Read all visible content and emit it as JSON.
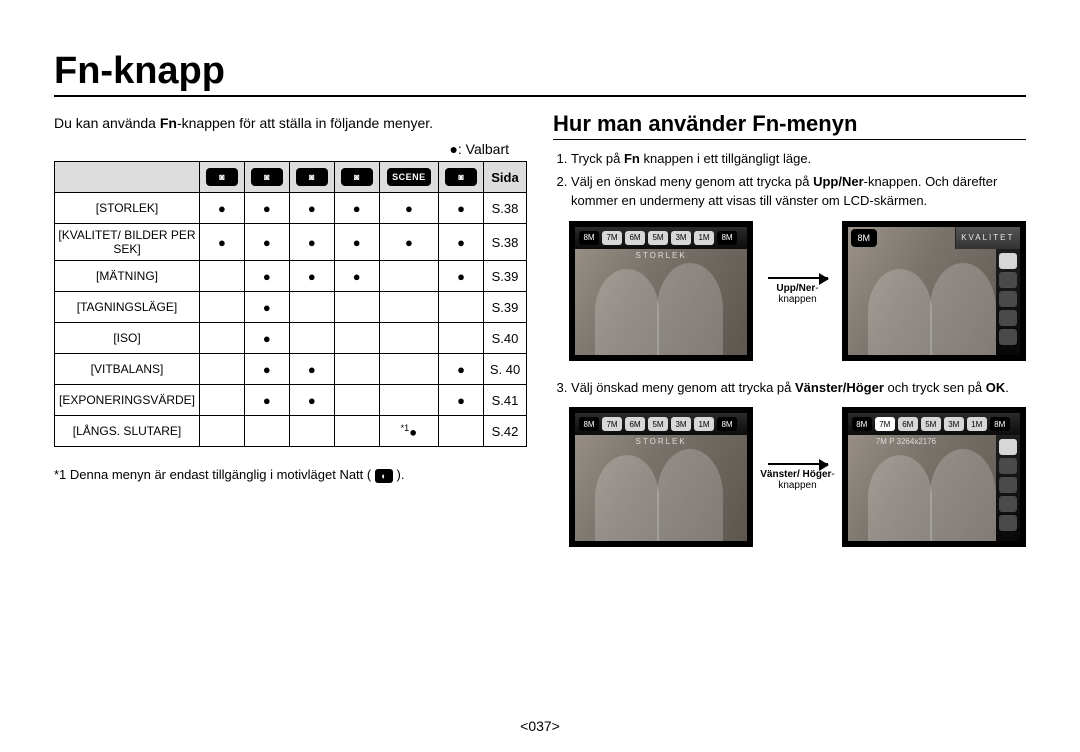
{
  "title": "Fn-knapp",
  "left": {
    "intro_pre": "Du kan använda ",
    "intro_bold": "Fn",
    "intro_post": "-knappen för att ställa in följande menyer.",
    "legend": "●: Valbart",
    "header": {
      "modes": [
        "◙",
        "◙",
        "◙",
        "◙",
        "SCENE",
        "◙"
      ],
      "page_label": "Sida"
    },
    "rows": [
      {
        "name": "[STORLEK]",
        "marks": [
          "●",
          "●",
          "●",
          "●",
          "●",
          "●"
        ],
        "page": "S.38"
      },
      {
        "name": "[KVALITET/ BILDER PER SEK]",
        "marks": [
          "●",
          "●",
          "●",
          "●",
          "●",
          "●"
        ],
        "page": "S.38"
      },
      {
        "name": "[MÄTNING]",
        "marks": [
          "",
          "●",
          "●",
          "●",
          "",
          "●"
        ],
        "page": "S.39"
      },
      {
        "name": "[TAGNINGSLÄGE]",
        "marks": [
          "",
          "●",
          "",
          "",
          "",
          ""
        ],
        "page": "S.39"
      },
      {
        "name": "[ISO]",
        "marks": [
          "",
          "●",
          "",
          "",
          "",
          ""
        ],
        "page": "S.40"
      },
      {
        "name": "[VITBALANS]",
        "marks": [
          "",
          "●",
          "●",
          "",
          "",
          "●"
        ],
        "page": "S. 40"
      },
      {
        "name": "[EXPONERINGSVÄRDE]",
        "marks": [
          "",
          "●",
          "●",
          "",
          "",
          "●"
        ],
        "page": "S.41"
      },
      {
        "name": "[LÅNGS. SLUTARE]",
        "marks": [
          "",
          "",
          "",
          "",
          "*1●",
          ""
        ],
        "page": "S.42"
      }
    ],
    "footnote_pre": "*1  Denna menyn är endast tillgänglig i motivläget Natt (",
    "footnote_icon": "◐",
    "footnote_post": ")."
  },
  "right": {
    "subhead": "Hur man använder Fn-menyn",
    "step1_pre": "Tryck på ",
    "step1_bold": "Fn",
    "step1_post": " knappen i ett tillgängligt läge.",
    "step2_pre": "Välj en önskad meny genom att trycka på ",
    "step2_bold": "Upp/Ner",
    "step2_post": "-knappen. Och därefter kommer en undermeny att visas till vänster om LCD-skärmen.",
    "step3_pre": "Välj önskad meny genom att trycka på ",
    "step3_bold": "Vänster/Höger",
    "step3_post1": " och tryck sen på ",
    "step3_bold2": "OK",
    "step3_post2": ".",
    "chips": [
      "8M",
      "7M",
      "6M",
      "5M",
      "3M",
      "1M",
      "8M"
    ],
    "lcd_label1": "STORLEK",
    "lcd_ribbon": "KVALITET",
    "lcd_bigchip": "8M",
    "sublabel2": "7M P 3264x2176",
    "arrow1_line1": "Upp/Ner",
    "arrow1_line2": "-knappen",
    "arrow2_line1": "Vänster/ Höger",
    "arrow2_line2": "-knappen"
  },
  "pagenum": "<037>"
}
